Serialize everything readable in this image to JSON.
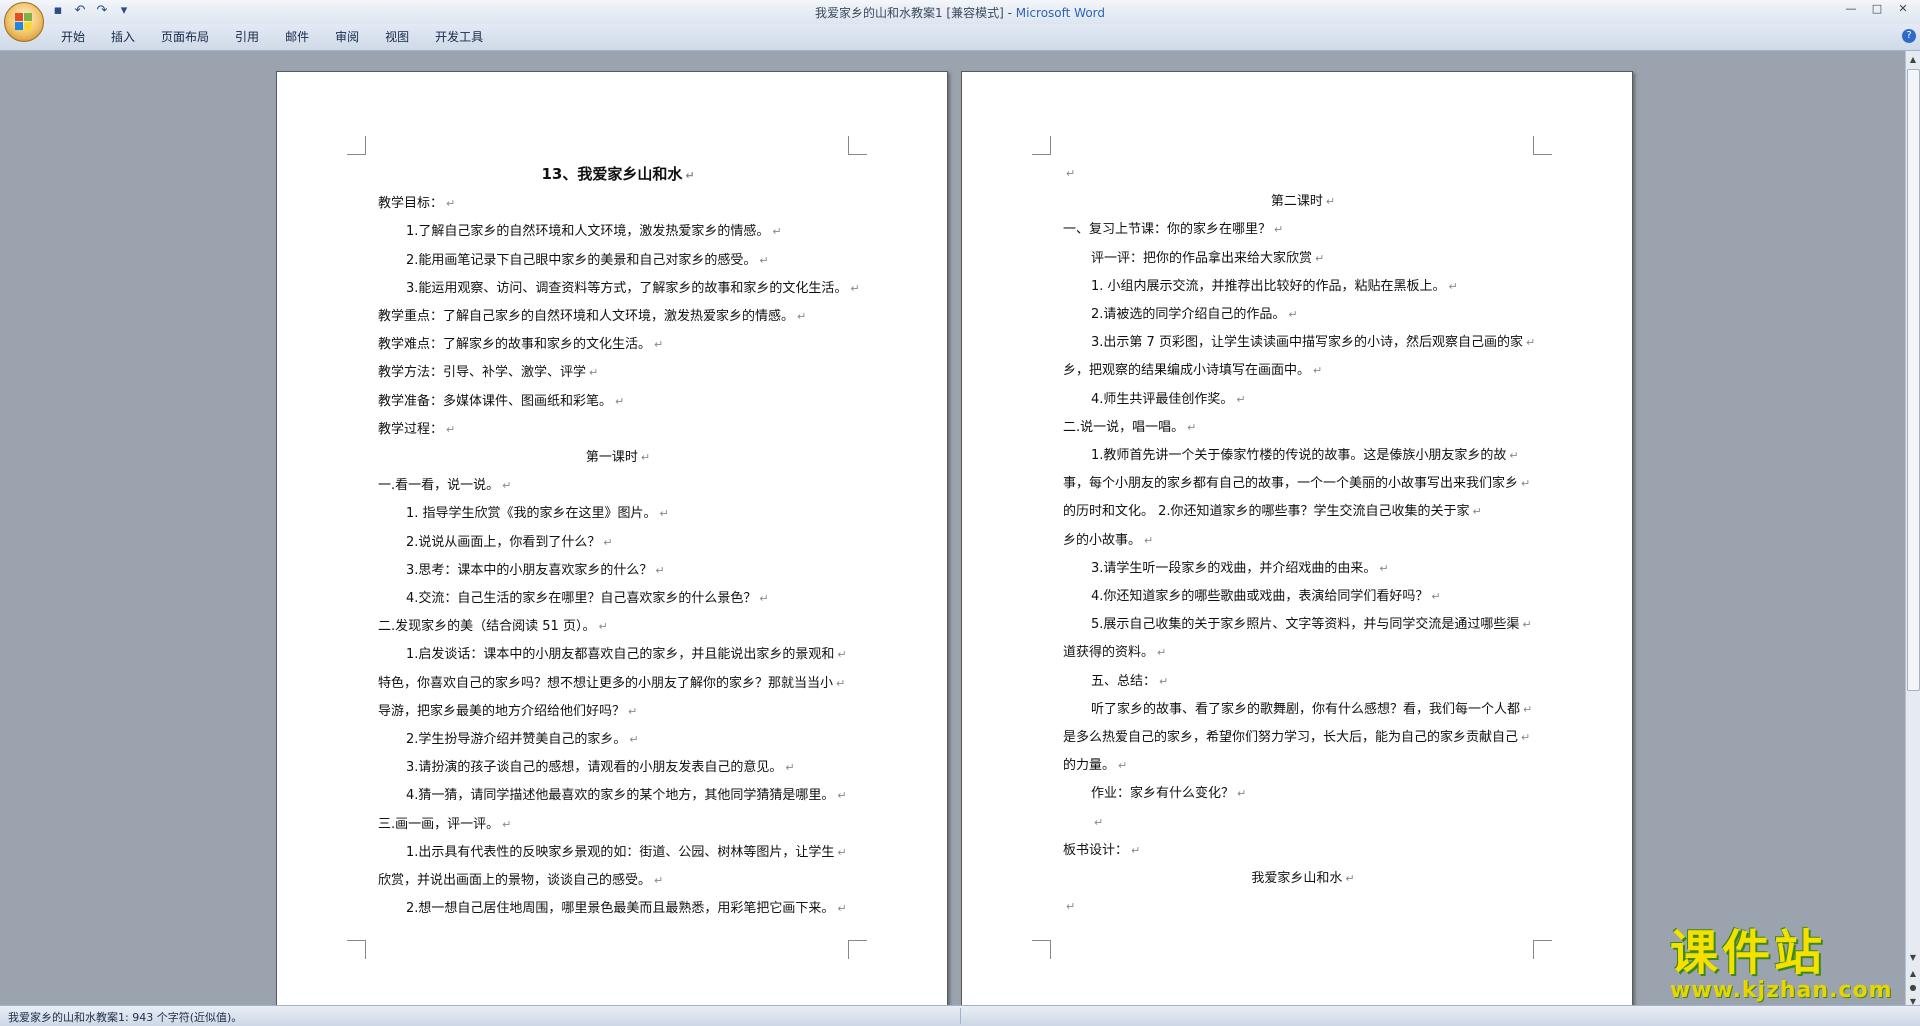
{
  "window": {
    "title": "我爱家乡的山和水教案1 [兼容模式] - ",
    "app_name": "Microsoft Word",
    "controls": {
      "minimize": "—",
      "maximize": "□",
      "close": "✕"
    }
  },
  "quick_access": [
    {
      "name": "save-icon",
      "glyph": "▪"
    },
    {
      "name": "undo-icon",
      "glyph": "↶"
    },
    {
      "name": "redo-icon",
      "glyph": "↷"
    },
    {
      "name": "customize-qat-icon",
      "glyph": "▾"
    }
  ],
  "ribbon": {
    "tabs": [
      "开始",
      "插入",
      "页面布局",
      "引用",
      "邮件",
      "审阅",
      "视图",
      "开发工具"
    ],
    "help": "?"
  },
  "page1": {
    "lines": [
      {
        "text": "13、我爱家乡山和水",
        "style": "title"
      },
      {
        "text": "教学目标：",
        "style": "plain"
      },
      {
        "text": "1.了解自己家乡的自然环境和人文环境，激发热爱家乡的情感。",
        "style": "indent"
      },
      {
        "text": "2.能用画笔记录下自己眼中家乡的美景和自己对家乡的感受。",
        "style": "indent"
      },
      {
        "text": "3.能运用观察、访问、调查资料等方式，了解家乡的故事和家乡的文化生活。",
        "style": "indent"
      },
      {
        "text": "教学重点：了解自己家乡的自然环境和人文环境，激发热爱家乡的情感。",
        "style": "plain"
      },
      {
        "text": "教学难点：了解家乡的故事和家乡的文化生活。",
        "style": "plain"
      },
      {
        "text": "教学方法：引导、补学、激学、评学",
        "style": "plain"
      },
      {
        "text": "教学准备：多媒体课件、图画纸和彩笔。",
        "style": "plain"
      },
      {
        "text": "教学过程：",
        "style": "plain"
      },
      {
        "text": "第一课时",
        "style": "center"
      },
      {
        "text": "一.看一看，说一说。",
        "style": "plain"
      },
      {
        "text": "1.  指导学生欣赏《我的家乡在这里》图片。",
        "style": "indent"
      },
      {
        "text": "2.说说从画面上，你看到了什么？",
        "style": "indent"
      },
      {
        "text": "3.思考：课本中的小朋友喜欢家乡的什么？",
        "style": "indent"
      },
      {
        "text": "4.交流：自己生活的家乡在哪里？自己喜欢家乡的什么景色？",
        "style": "indent"
      },
      {
        "text": "二.发现家乡的美（结合阅读 51 页）。",
        "style": "plain"
      },
      {
        "text": "1.启发谈话：课本中的小朋友都喜欢自己的家乡，并且能说出家乡的景观和",
        "style": "indent"
      },
      {
        "text": "特色，你喜欢自己的家乡吗？想不想让更多的小朋友了解你的家乡？那就当当小",
        "style": "plain"
      },
      {
        "text": "导游，把家乡最美的地方介绍给他们好吗？",
        "style": "plain"
      },
      {
        "text": "2.学生扮导游介绍并赞美自己的家乡。",
        "style": "indent"
      },
      {
        "text": "3.请扮演的孩子谈自己的感想，请观看的小朋友发表自己的意见。",
        "style": "indent"
      },
      {
        "text": "4.猜一猜，请同学描述他最喜欢的家乡的某个地方，其他同学猜猜是哪里。",
        "style": "indent"
      },
      {
        "text": "三.画一画，评一评。",
        "style": "plain"
      },
      {
        "text": "1.出示具有代表性的反映家乡景观的如：街道、公园、树林等图片，让学生",
        "style": "indent"
      },
      {
        "text": "欣赏，并说出画面上的景物，谈谈自己的感受。",
        "style": "plain"
      },
      {
        "text": "2.想一想自己居住地周围，哪里景色最美而且最熟悉，用彩笔把它画下来。",
        "style": "indent"
      }
    ]
  },
  "page2": {
    "lines": [
      {
        "text": "",
        "style": "plain"
      },
      {
        "text": "第二课时",
        "style": "center"
      },
      {
        "text": "一、复习上节课：你的家乡在哪里？",
        "style": "plain"
      },
      {
        "text": "评一评：把你的作品拿出来给大家欣赏",
        "style": "indent"
      },
      {
        "text": "1.  小组内展示交流，并推荐出比较好的作品，粘贴在黑板上。",
        "style": "indent"
      },
      {
        "text": "2.请被选的同学介绍自己的作品。",
        "style": "indent"
      },
      {
        "text": "3.出示第 7 页彩图，让学生读读画中描写家乡的小诗，然后观察自己画的家",
        "style": "indent"
      },
      {
        "text": "乡，把观察的结果编成小诗填写在画面中。",
        "style": "plain"
      },
      {
        "text": "4.师生共评最佳创作奖。",
        "style": "indent"
      },
      {
        "text": "二.说一说，唱一唱。",
        "style": "plain"
      },
      {
        "text": "1.教师首先讲一个关于傣家竹楼的传说的故事。这是傣族小朋友家乡的故",
        "style": "indent"
      },
      {
        "text": "事，每个小朋友的家乡都有自己的故事，一个一个美丽的小故事写出来我们家乡",
        "style": "plain"
      },
      {
        "text": "的历时和文化。          2.你还知道家乡的哪些事？学生交流自己收集的关于家",
        "style": "plain"
      },
      {
        "text": "乡的小故事。",
        "style": "plain"
      },
      {
        "text": "3.请学生听一段家乡的戏曲，并介绍戏曲的由来。",
        "style": "indent"
      },
      {
        "text": "4.你还知道家乡的哪些歌曲或戏曲，表演给同学们看好吗？",
        "style": "indent"
      },
      {
        "text": "5.展示自己收集的关于家乡照片、文字等资料，并与同学交流是通过哪些渠",
        "style": "indent"
      },
      {
        "text": "道获得的资料。",
        "style": "plain"
      },
      {
        "text": "五、总结：",
        "style": "indent"
      },
      {
        "text": "听了家乡的故事、看了家乡的歌舞剧，你有什么感想？看，我们每一个人都",
        "style": "indent"
      },
      {
        "text": "是多么热爱自己的家乡，希望你们努力学习，长大后，能为自己的家乡贡献自己",
        "style": "plain"
      },
      {
        "text": "的力量。",
        "style": "plain"
      },
      {
        "text": "作业：家乡有什么变化？",
        "style": "indent"
      },
      {
        "text": "",
        "style": "indent"
      },
      {
        "text": "板书设计：",
        "style": "plain"
      },
      {
        "text": "我爱家乡山和水",
        "style": "center"
      },
      {
        "text": "",
        "style": "plain"
      }
    ]
  },
  "status_bar": {
    "text": "我爱家乡的山和水教案1: 943 个字符(近似值)。"
  },
  "watermark": {
    "big": "课件站",
    "small": "www.kjzhan.com"
  },
  "colors": {
    "title_app": "#2e64b2",
    "watermark_fill": "#f6e000",
    "watermark_outline": "#3a8a18"
  }
}
